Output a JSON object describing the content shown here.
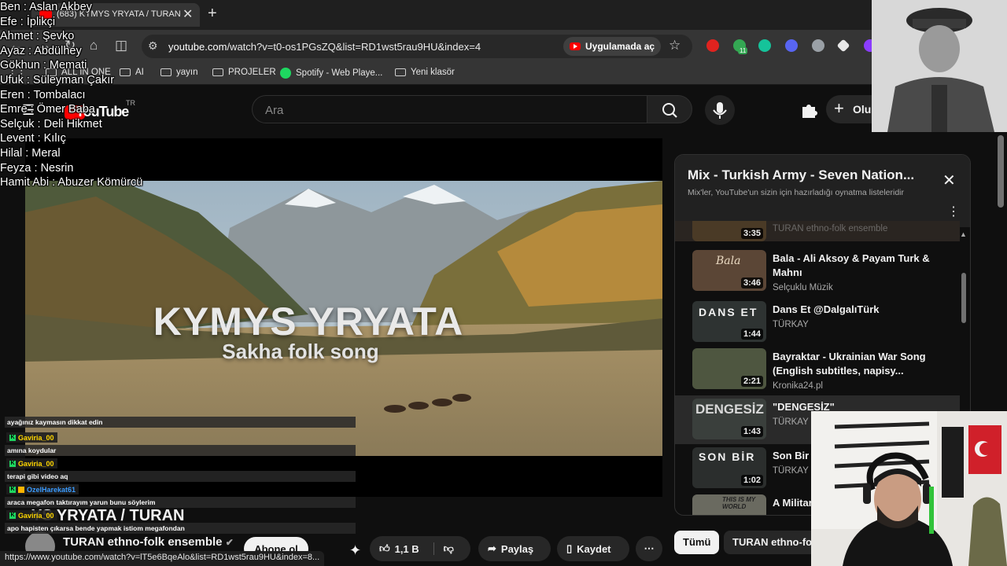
{
  "browser": {
    "tab_title": "(683) KYMYS YRYATA / TURAN",
    "url_host": "youtube.com",
    "url_path": "/watch?v=t0-os1PGsZQ&list=RD1wst5rau9HU&index=4",
    "open_in_app": "Uygulamada aç",
    "extension_badge": "11",
    "bookmarks": [
      "ALL IN ONE",
      "AI",
      "yayın",
      "PROJELER",
      "Spotify - Web Playe...",
      "Yeni klasör"
    ],
    "status_url": "https://www.youtube.com/watch?v=lT5e6BqeAlo&list=RD1wst5rau9HU&index=8..."
  },
  "youtube": {
    "logo": "YouTube",
    "region": "TR",
    "search_placeholder": "Ara",
    "create_label": "Oluş"
  },
  "video": {
    "overlay_title": "KYMYS YRYATA",
    "overlay_subtitle": "Sakha folk song",
    "title_visible": "YS YRYATA / TURAN",
    "channel": "TURAN ethno-folk ensemble",
    "subscribe": "Abone ol",
    "likes": "1,1 B",
    "share": "Paylaş",
    "save": "Kaydet"
  },
  "playlist": {
    "title": "Mix - Turkish Army - Seven Nation...",
    "subtitle": "Mix'ler, YouTube'un sizin için hazırladığı oynatma listeleridir",
    "items": [
      {
        "title": "",
        "channel": "TURAN ethno-folk ensemble",
        "duration": "3:35"
      },
      {
        "title": "Bala - Ali Aksoy & Payam Turk & Mahnı",
        "channel": "Selçuklu Müzik",
        "duration": "3:46",
        "thumb_text": "Bala"
      },
      {
        "title": "Dans Et @DalgalıTürk",
        "channel": "TÜRKAY",
        "duration": "1:44",
        "thumb_text": "DANS ET"
      },
      {
        "title": "Bayraktar - Ukrainian War Song (English subtitles, napisy...",
        "channel": "Kronika24.pl",
        "duration": "2:21"
      },
      {
        "title": "\"DENGESİZ\"",
        "channel": "TÜRKAY",
        "duration": "1:43",
        "thumb_text": "DENGESİZ"
      },
      {
        "title": "Son Bir",
        "channel": "TÜRKAY",
        "duration": "1:02",
        "thumb_text": "SON BİR"
      },
      {
        "title": "A Militar",
        "channel": "",
        "duration": "",
        "thumb_text": "THIS IS MY WORLD"
      }
    ]
  },
  "chips": [
    "Tümü",
    "TURAN ethno-fol"
  ],
  "cast_list": [
    "Ben : Aslan Akbey",
    "Efe : İplikçi",
    "Ahmet : Şevko",
    "Ayaz : Abdülhey",
    "Gökhun : Memati",
    "Ufuk : Süleyman Çakır",
    "Eren : Tombalacı",
    "Emre : Ömer Baba",
    "Selçuk : Deli Hikmet",
    "Levent : Kılıç",
    "Hilal : Meral",
    "Feyza : Nesrin",
    "Hamit Abi : Abuzer Kömürcü"
  ],
  "chat": [
    {
      "user": "",
      "message": "ayağınız kaymasın dikkat edin"
    },
    {
      "user": "Gaviria_00",
      "message": "amına koydular"
    },
    {
      "user": "Gaviria_00",
      "message": "terapi gibi video aq"
    },
    {
      "user": "OzelHarekat61",
      "message": "araca megafon taktırayım yarun bunu söylerim"
    },
    {
      "user": "Gaviria_00",
      "message": "apo hapisten çıkarsa bende yapmak istiom megafondan"
    }
  ],
  "colors": {
    "youtube_red": "#ff0000",
    "chat_gold": "#ffd700",
    "chat_blue": "#3a9bff"
  }
}
